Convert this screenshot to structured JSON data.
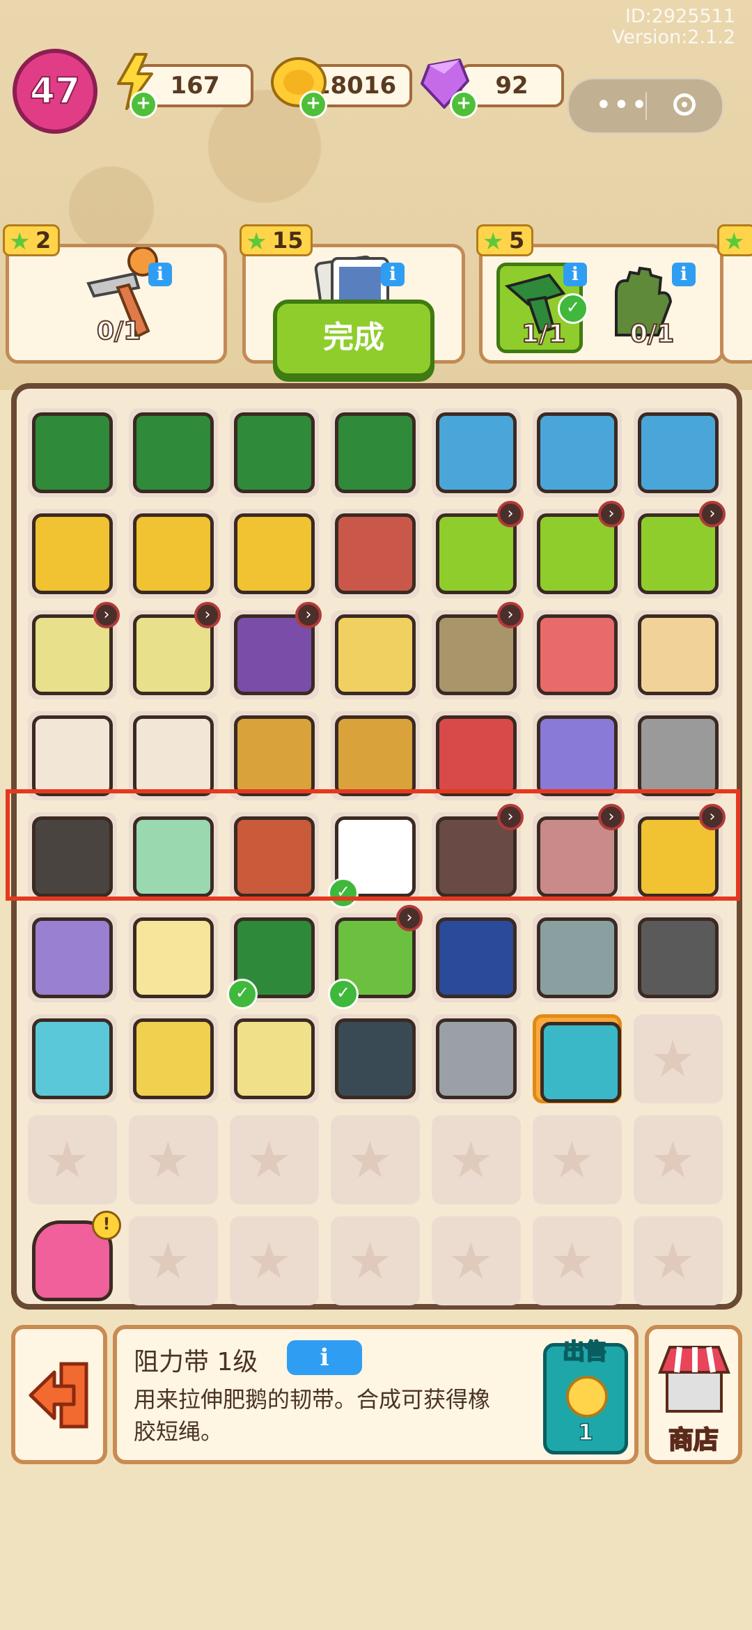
{
  "meta": {
    "id_text": "ID:2925511",
    "version_text": "Version:2.1.2"
  },
  "status": {
    "level": "47",
    "energy": "167",
    "coins": "18016",
    "gems": "92",
    "plus_symbol": "+",
    "miniapp_dots": "•••"
  },
  "orders": [
    {
      "stars": "2",
      "progress": "0/1",
      "icon": "hammer-icon",
      "completed": false
    },
    {
      "stars": "15",
      "progress": "",
      "icon": "photo-cards-icon",
      "completed": false
    },
    {
      "stars": "5",
      "progress": "1/1",
      "icon": "drill-icon",
      "completed": true
    },
    {
      "stars": "",
      "progress": "0/1",
      "icon": "gloves-icon",
      "completed": false
    }
  ],
  "done_button": "完成",
  "board": {
    "rows": [
      [
        "toolbox-icon",
        "toolbox-icon",
        "toolbox-icon",
        "toolbox-icon",
        "robot-vacuum-icon",
        "robot-vacuum-icon",
        "robot-vacuum-icon"
      ],
      [
        "shopping-cart-icon",
        "shopping-cart-icon",
        "shopping-cart-icon",
        "wheelbarrow-icon",
        "laptop-icon",
        "laptop-icon",
        "laptop-icon"
      ],
      [
        "basket-icon",
        "basket-icon",
        "bag-icon",
        "plant-pot-icon",
        "cabinet-icon",
        "box-icon",
        "bread-icon"
      ],
      [
        "cat-icon",
        "cat-icon",
        "cardboard-box-icon",
        "cardboard-box-icon",
        "vr-headset-icon",
        "cards-icon",
        "shovel-icon"
      ],
      [
        "tire-icon",
        "hair-clipper-icon",
        "building-icon",
        "photo-card-icon",
        "camera-icon",
        "tablet-icon",
        "cloth-stack-icon"
      ],
      [
        "cart-machine-icon",
        "paint-bucket-icon",
        "drill-icon",
        "potted-tree-icon",
        "headphones-icon",
        "dumbbell-rack-icon",
        "treadmill-icon"
      ],
      [
        "dumbbell-icon",
        "jump-rope-icon",
        "yarn-ball-icon",
        "weight-plate-icon",
        "chest-expander-icon",
        "resistance-band-icon",
        "empty"
      ],
      [
        "empty",
        "empty",
        "empty",
        "empty",
        "empty",
        "empty",
        "empty"
      ],
      [
        "backpack-icon",
        "empty",
        "empty",
        "empty",
        "empty",
        "empty",
        "empty"
      ]
    ],
    "selected_index": [
      6,
      5
    ],
    "highlighted_row": 4,
    "empty_symbol": "★",
    "timer_symbol": "›",
    "check_symbol": "✓",
    "alert_symbol": "!"
  },
  "info_panel": {
    "name": "阻力带 1级",
    "info_button": "i",
    "description": "用来拉伸肥鹅的韧带。合成可获得橡胶短绳。",
    "sell_label": "出售",
    "sell_price": "1"
  },
  "shop_label": "商店",
  "colors": {
    "accent_green": "#8fcd2d",
    "info_blue": "#2f9ef2",
    "highlight_red": "#e5391f",
    "level_pink": "#e13d86"
  }
}
